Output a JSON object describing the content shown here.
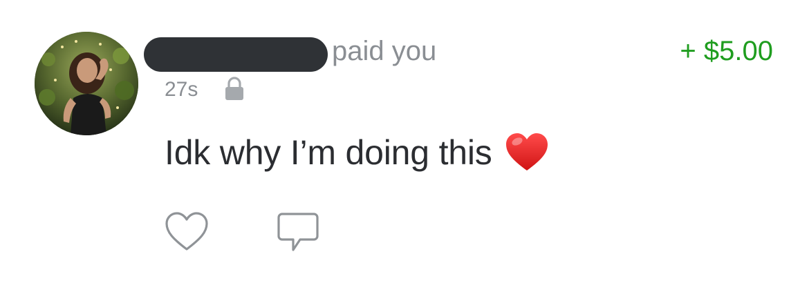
{
  "feed_item": {
    "actor_name_redacted": true,
    "action_text": "paid you",
    "amount": "+ $5.00",
    "timestamp": "27s",
    "privacy_icon": "lock-icon",
    "message": "Idk why I’m doing this",
    "message_emoji": "red-heart-emoji",
    "actions": {
      "like_icon": "heart-outline-icon",
      "comment_icon": "speech-bubble-icon"
    },
    "colors": {
      "amount": "#1f9d1f",
      "secondary_text": "#8a8e93",
      "primary_text": "#2b2d31",
      "icon_gray": "#8a8e93",
      "redaction": "#2f3236"
    }
  }
}
